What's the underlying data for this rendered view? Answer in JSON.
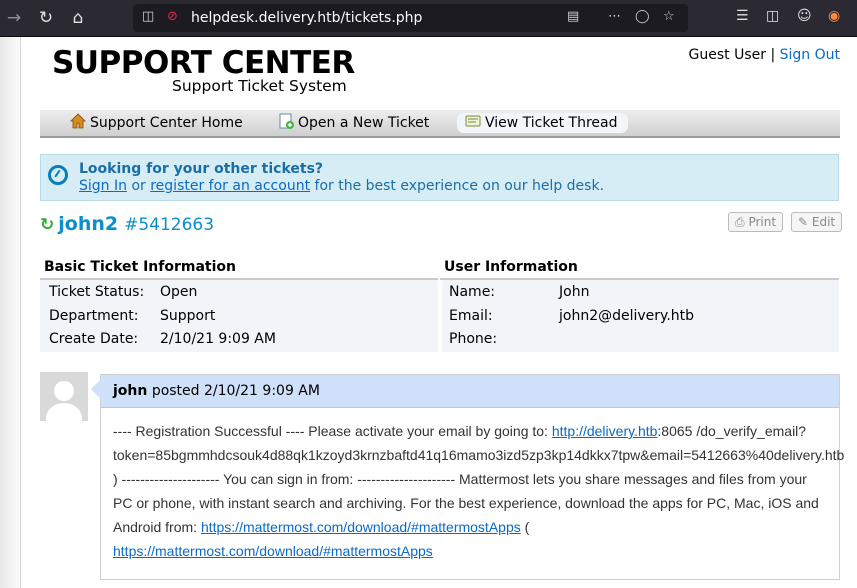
{
  "browser": {
    "url": "helpdesk.delivery.htb/tickets.php",
    "back_icon": "arrow-left-icon",
    "reload_icon": "reload-icon",
    "home_icon": "home-icon"
  },
  "header": {
    "logo_main": "SUPPORT CENTER",
    "logo_sub": "Support Ticket System",
    "user_label": "Guest User",
    "separator": "|",
    "signout_label": "Sign Out"
  },
  "nav": {
    "items": [
      {
        "label": "Support Center Home",
        "icon": "home-icon"
      },
      {
        "label": "Open a New Ticket",
        "icon": "new-ticket-icon"
      },
      {
        "label": "View Ticket Thread",
        "icon": "ticket-thread-icon"
      }
    ]
  },
  "notice": {
    "title": "Looking for your other tickets?",
    "signin_link": "Sign In",
    "or_text": " or ",
    "register_link": "register for an account",
    "tail_text": " for the best experience on our help desk."
  },
  "ticket": {
    "name": "john2",
    "number": "#5412663",
    "print_label": "Print",
    "edit_label": "Edit"
  },
  "basic_info": {
    "heading": "Basic Ticket Information",
    "rows": [
      {
        "label": "Ticket Status:",
        "value": "Open"
      },
      {
        "label": "Department:",
        "value": "Support"
      },
      {
        "label": "Create Date:",
        "value": "2/10/21 9:09 AM"
      }
    ]
  },
  "user_info": {
    "heading": "User Information",
    "rows": [
      {
        "label": "Name:",
        "value": "John"
      },
      {
        "label": "Email:",
        "value": "john2@delivery.htb"
      },
      {
        "label": "Phone:",
        "value": ""
      }
    ]
  },
  "thread": {
    "author": "john",
    "posted_text": "posted 2/10/21 9:09 AM",
    "body_1": "---- Registration Successful ---- Please activate your email by going to: ",
    "link_1": "http://delivery.htb",
    "body_2": ":8065 /do_verify_email?token=85bgmmhdcsouk4d88qk1kzoyd3krnzbaftd41q16mamo3izd5zp3kp14dkkx7tpw&email=5412663%40delivery.htb ) --------------------- You can sign in from: --------------------- Mattermost lets you share messages and files from your PC or phone, with instant search and archiving. For the best experience, download the apps for PC, Mac, iOS and Android from: ",
    "link_2": "https://mattermost.com/download/#mattermostApps",
    "body_3": " ( ",
    "link_3": "https://mattermost.com/download/#mattermostApps"
  },
  "colors": {
    "link": "#0a6ac7",
    "ticket_blue": "#0a8ed0",
    "notice_bg": "#d6edf6",
    "thread_head_bg": "#cfe0fa"
  }
}
